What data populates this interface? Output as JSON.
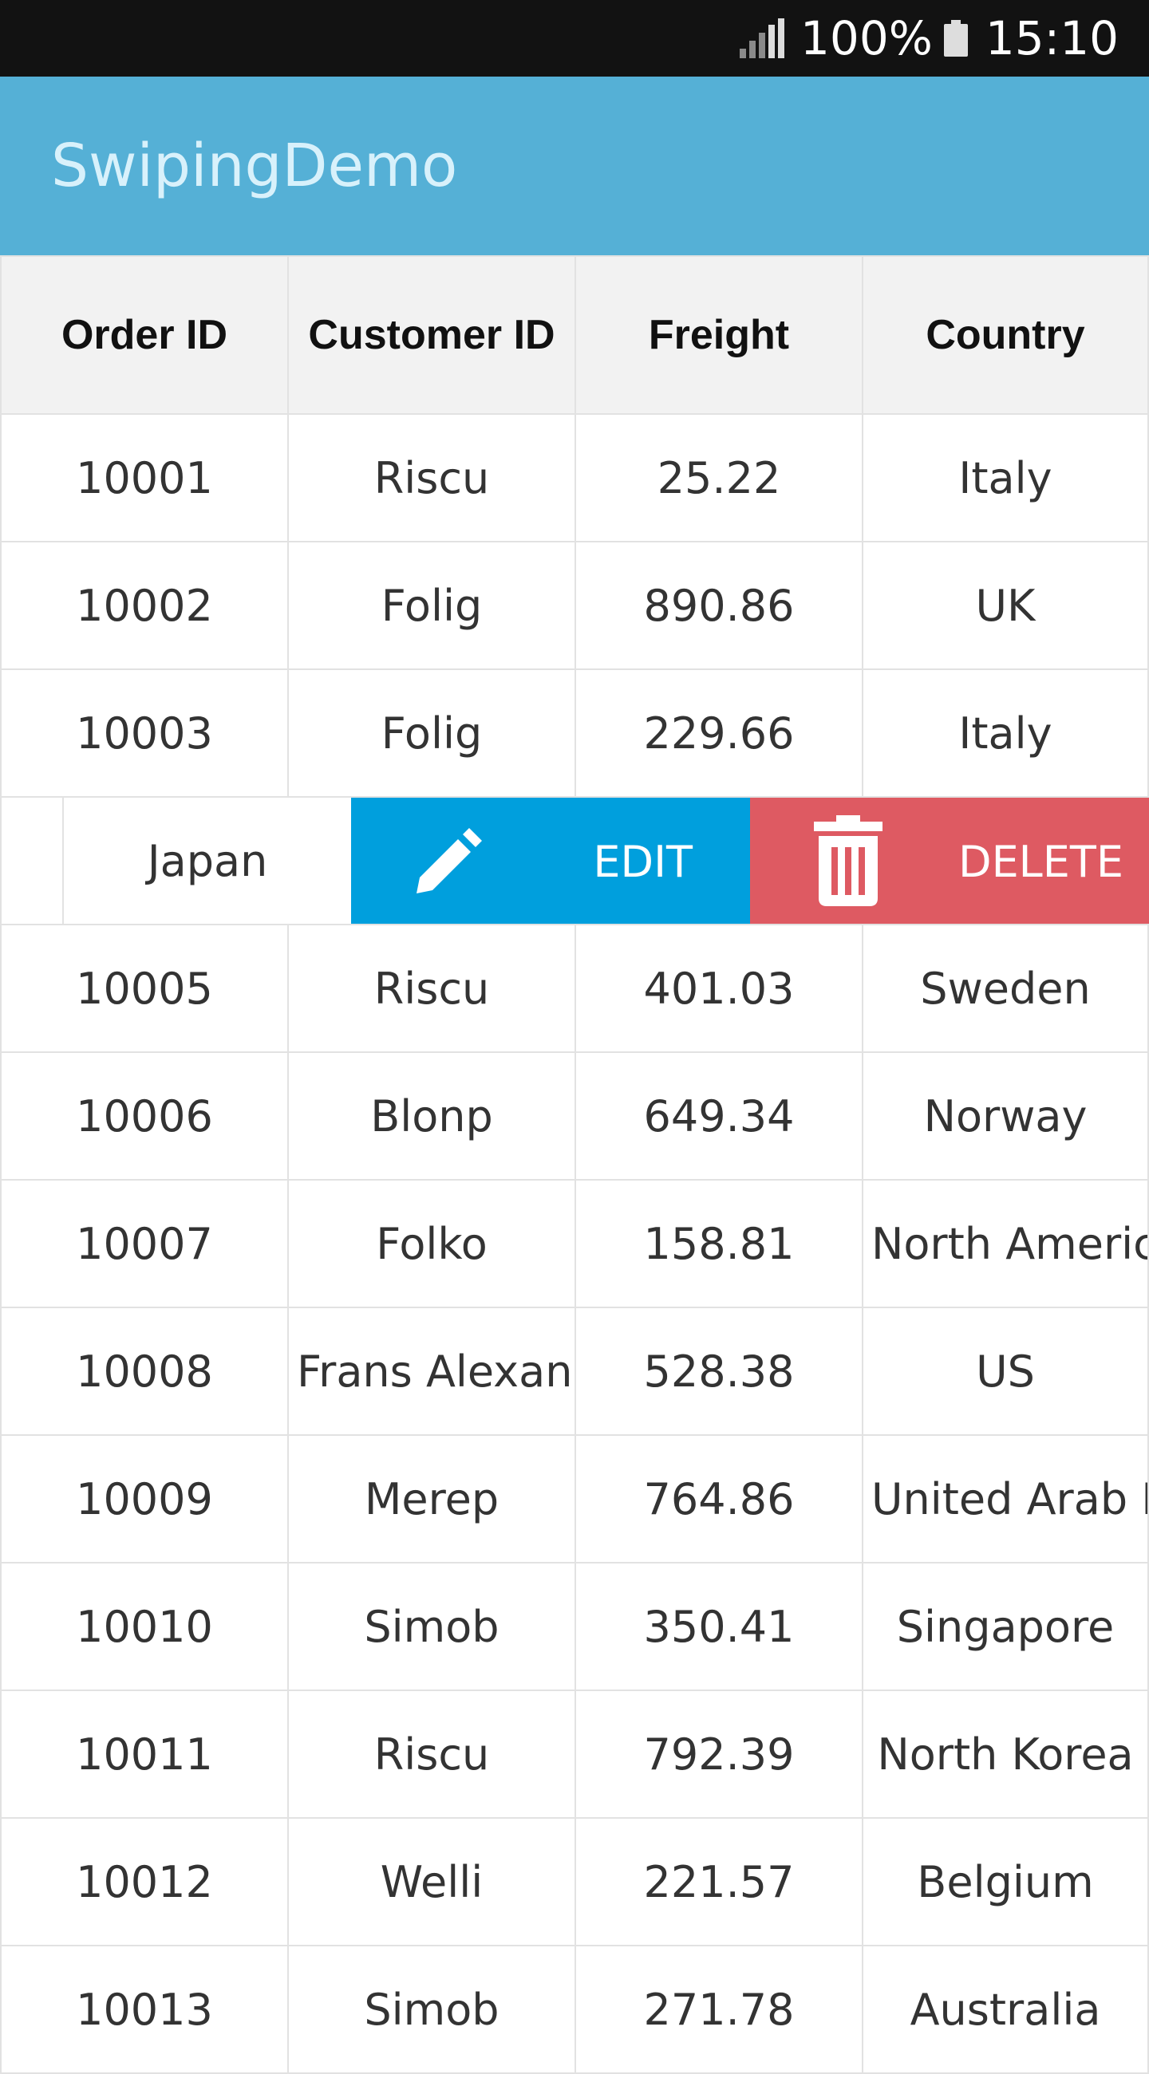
{
  "status_bar": {
    "battery_text": "100%",
    "time": "15:10",
    "icons": [
      "signal-icon",
      "battery-icon"
    ]
  },
  "app_bar": {
    "title": "SwipingDemo"
  },
  "grid": {
    "columns": [
      "Order ID",
      "Customer ID",
      "Freight",
      "Country"
    ],
    "rows_before": [
      {
        "order_id": "10001",
        "customer_id": "Riscu",
        "freight": "25.22",
        "country": "Italy"
      },
      {
        "order_id": "10002",
        "customer_id": "Folig",
        "freight": "890.86",
        "country": "UK"
      },
      {
        "order_id": "10003",
        "customer_id": "Folig",
        "freight": "229.66",
        "country": "Italy"
      }
    ],
    "swiped_row": {
      "country": "Japan",
      "edit_label": "EDIT",
      "delete_label": "DELETE",
      "edit_icon": "pencil-icon",
      "delete_icon": "trash-icon",
      "colors": {
        "edit": "#009fdd",
        "delete": "#de5a62"
      }
    },
    "rows_after": [
      {
        "order_id": "10005",
        "customer_id": "Riscu",
        "freight": "401.03",
        "country": "Sweden"
      },
      {
        "order_id": "10006",
        "customer_id": "Blonp",
        "freight": "649.34",
        "country": "Norway"
      },
      {
        "order_id": "10007",
        "customer_id": "Folko",
        "freight": "158.81",
        "country": "North America"
      },
      {
        "order_id": "10008",
        "customer_id": "Frans Alexander",
        "freight": "528.38",
        "country": "US"
      },
      {
        "order_id": "10009",
        "customer_id": "Merep",
        "freight": "764.86",
        "country": "United Arab Emirates"
      },
      {
        "order_id": "10010",
        "customer_id": "Simob",
        "freight": "350.41",
        "country": "Singapore"
      },
      {
        "order_id": "10011",
        "customer_id": "Riscu",
        "freight": "792.39",
        "country": "North Korea"
      },
      {
        "order_id": "10012",
        "customer_id": "Welli",
        "freight": "221.57",
        "country": "Belgium"
      },
      {
        "order_id": "10013",
        "customer_id": "Simob",
        "freight": "271.78",
        "country": "Australia"
      }
    ]
  },
  "colors": {
    "status_bar": "#121212",
    "app_bar": "#55b0d6",
    "header_bg": "#f2f2f2"
  }
}
